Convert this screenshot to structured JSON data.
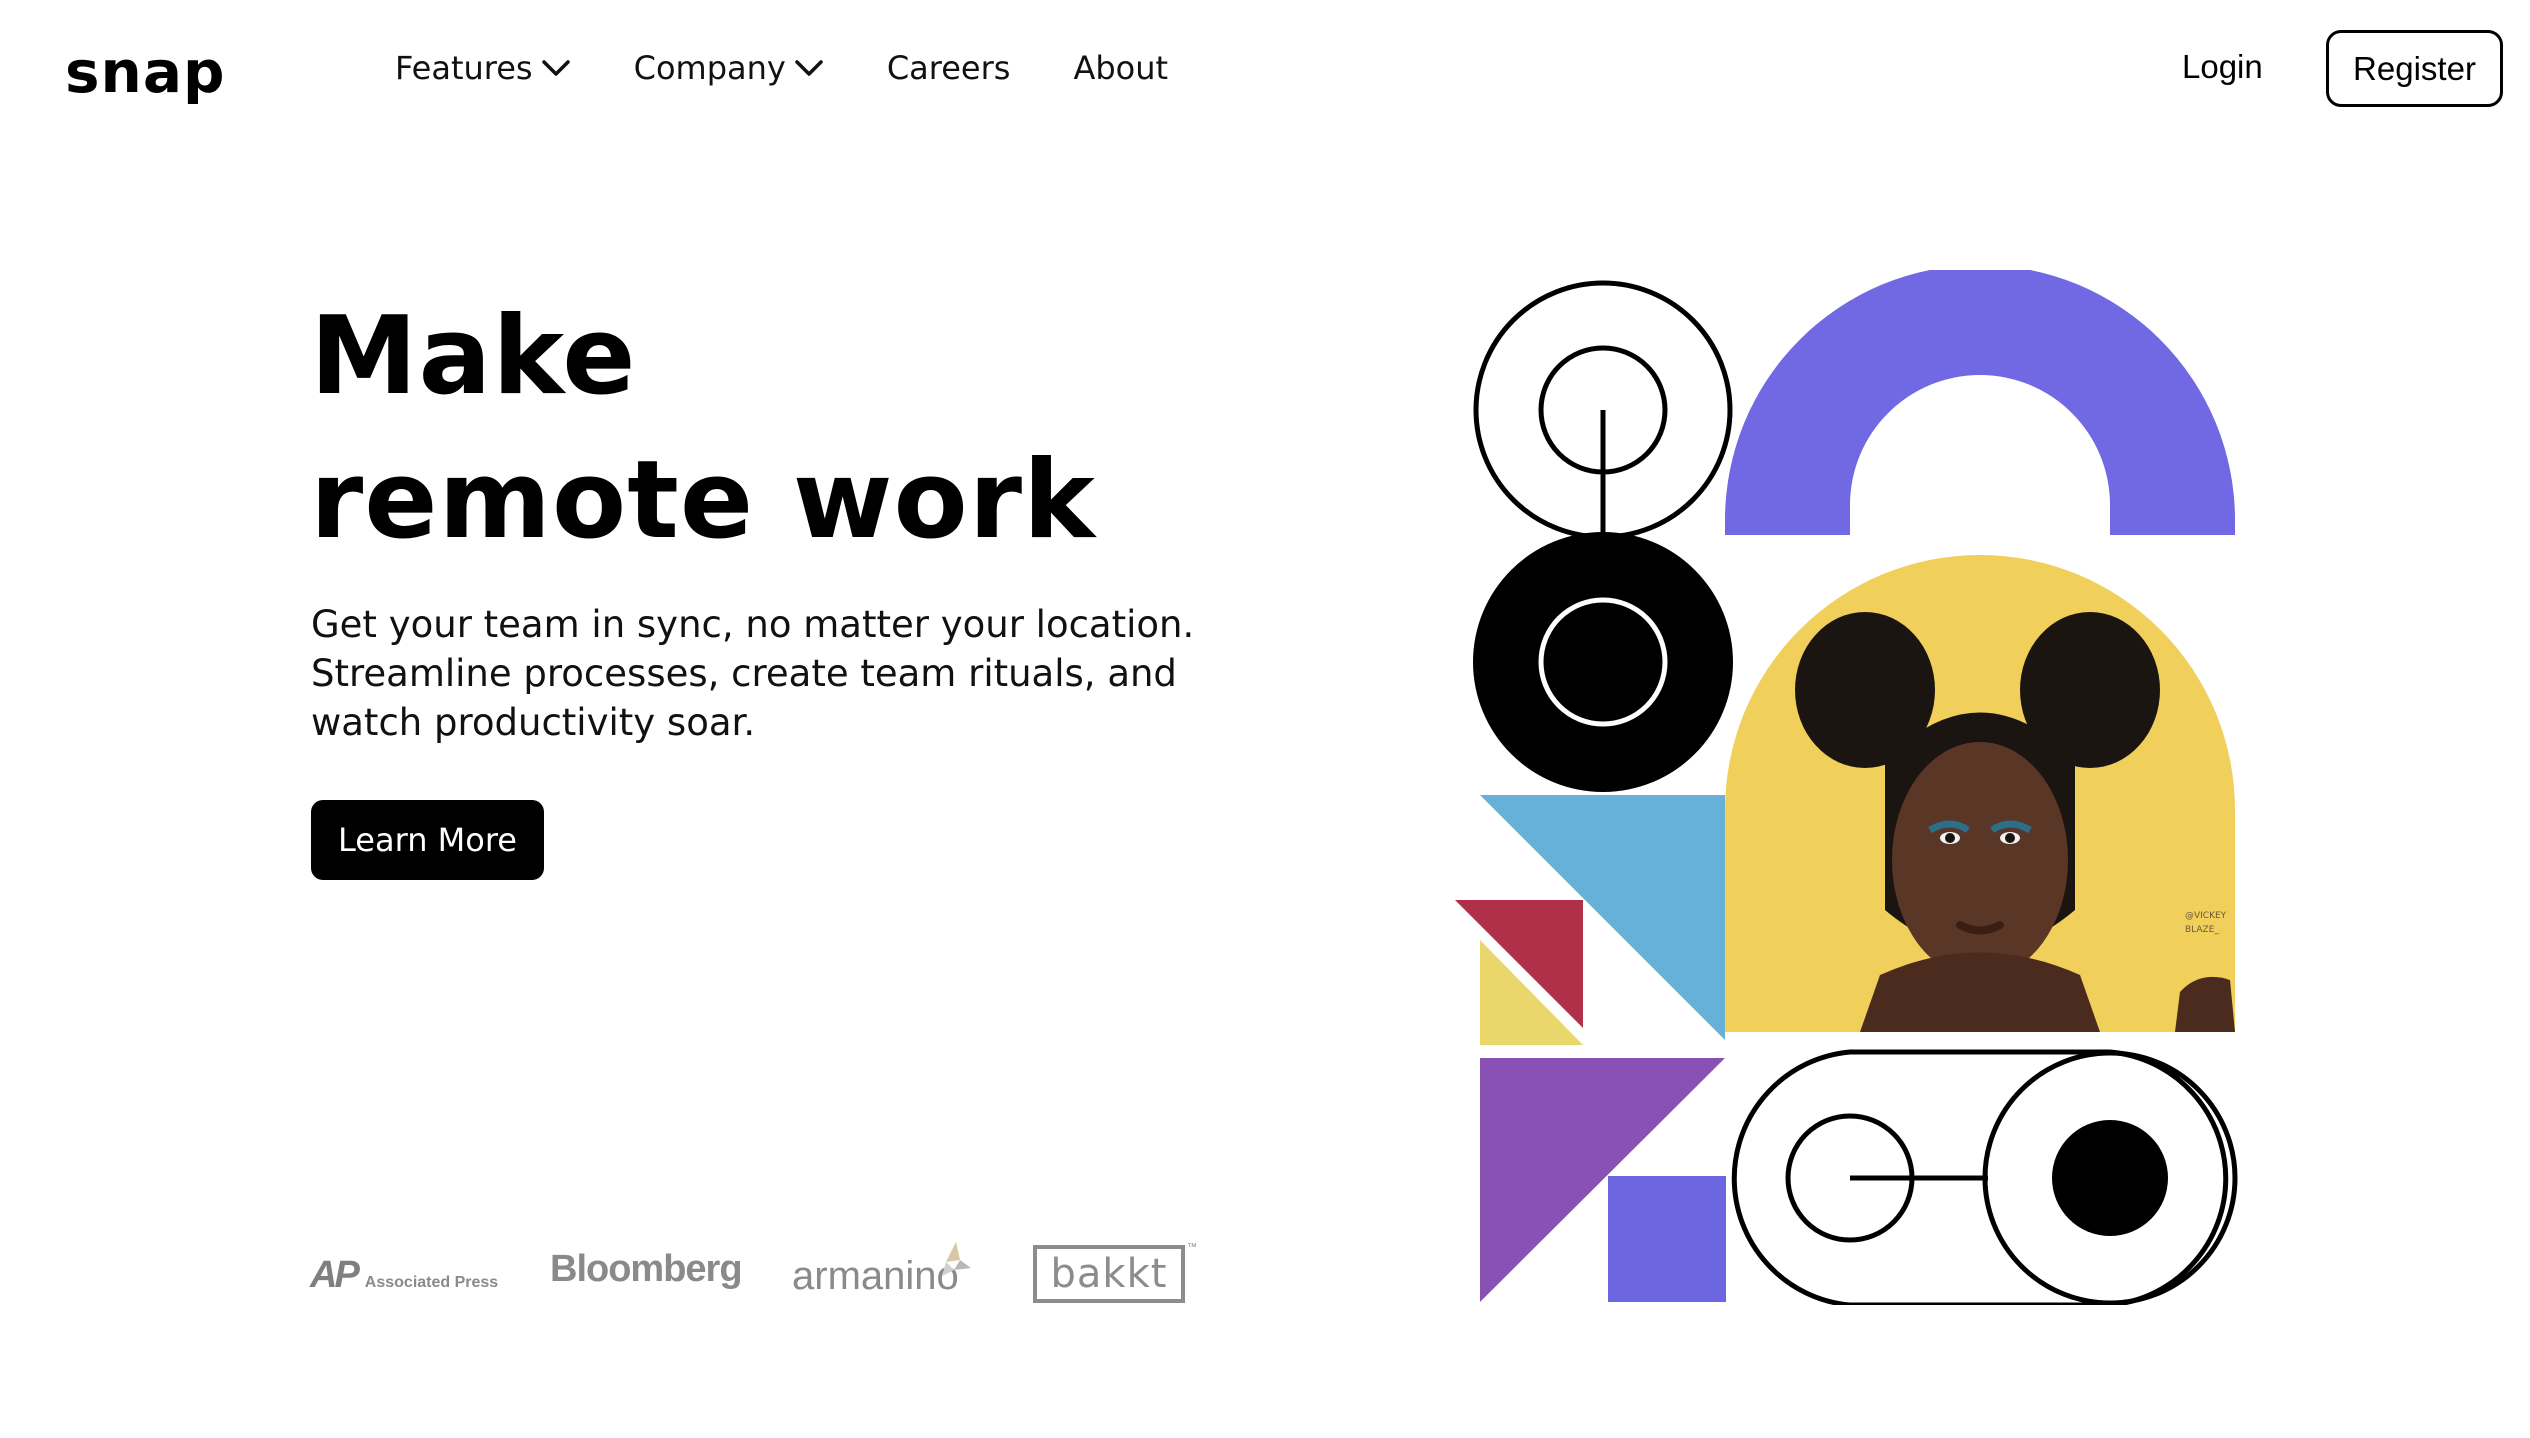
{
  "header": {
    "logo": "snap",
    "nav": [
      {
        "label": "Features",
        "has_dropdown": true
      },
      {
        "label": "Company",
        "has_dropdown": true
      },
      {
        "label": "Careers",
        "has_dropdown": false
      },
      {
        "label": "About",
        "has_dropdown": false
      }
    ],
    "login_label": "Login",
    "register_label": "Register"
  },
  "hero": {
    "title_line1": "Make",
    "title_line2": "remote work",
    "text_line1": "Get your team in sync, no matter your location.",
    "text_line2": "Streamline processes, create team rituals, and",
    "text_line3": "watch productivity soar.",
    "cta_label": "Learn More"
  },
  "clients": {
    "ap_mark": "AP",
    "ap_text": "Associated Press",
    "bloomberg": "Bloomberg",
    "armanino": "armanino",
    "bakkt": "bakkt",
    "bakkt_tm": "™"
  },
  "illustration": {
    "photo_credit_line1": "@VICKEY",
    "photo_credit_line2": "BLAZE_"
  },
  "colors": {
    "purple": "#7069e3",
    "yellow": "#f0cf5b",
    "sky_blue": "#67b0d8",
    "crimson": "#b02f49",
    "pale_yellow": "#e9d76b",
    "violet": "#8951b3",
    "indigo_square": "#6c66e0",
    "text": "#000000",
    "logo_gray": "#8a8a8a"
  },
  "icons": [
    "chevron-down-icon",
    "chevron-down-icon"
  ]
}
